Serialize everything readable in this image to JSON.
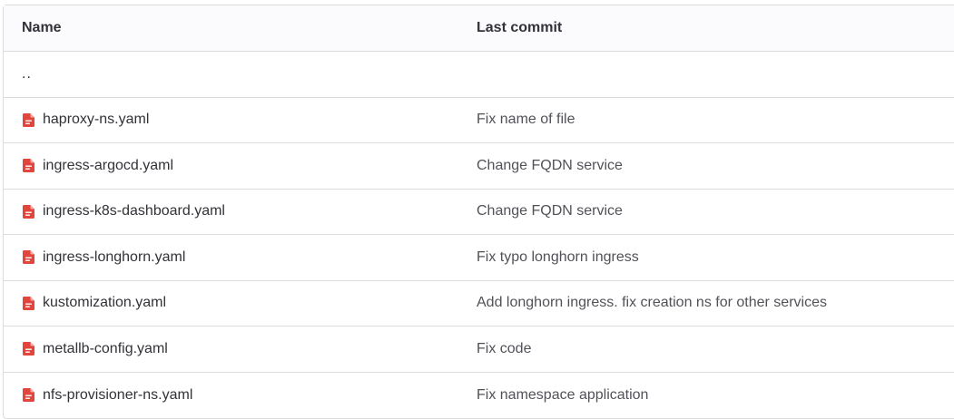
{
  "header": {
    "name_label": "Name",
    "commit_label": "Last commit"
  },
  "parent": {
    "label": ".."
  },
  "colors": {
    "file_icon": "#e2453c",
    "border": "#dcdcde",
    "header_bg": "#fbfafd"
  },
  "icons": {
    "file": "file-text-icon"
  },
  "files": [
    {
      "name": "haproxy-ns.yaml",
      "commit": "Fix name of file"
    },
    {
      "name": "ingress-argocd.yaml",
      "commit": "Change FQDN service"
    },
    {
      "name": "ingress-k8s-dashboard.yaml",
      "commit": "Change FQDN service"
    },
    {
      "name": "ingress-longhorn.yaml",
      "commit": "Fix typo longhorn ingress"
    },
    {
      "name": "kustomization.yaml",
      "commit": "Add longhorn ingress. fix creation ns for other services"
    },
    {
      "name": "metallb-config.yaml",
      "commit": "Fix code"
    },
    {
      "name": "nfs-provisioner-ns.yaml",
      "commit": "Fix namespace application"
    }
  ]
}
